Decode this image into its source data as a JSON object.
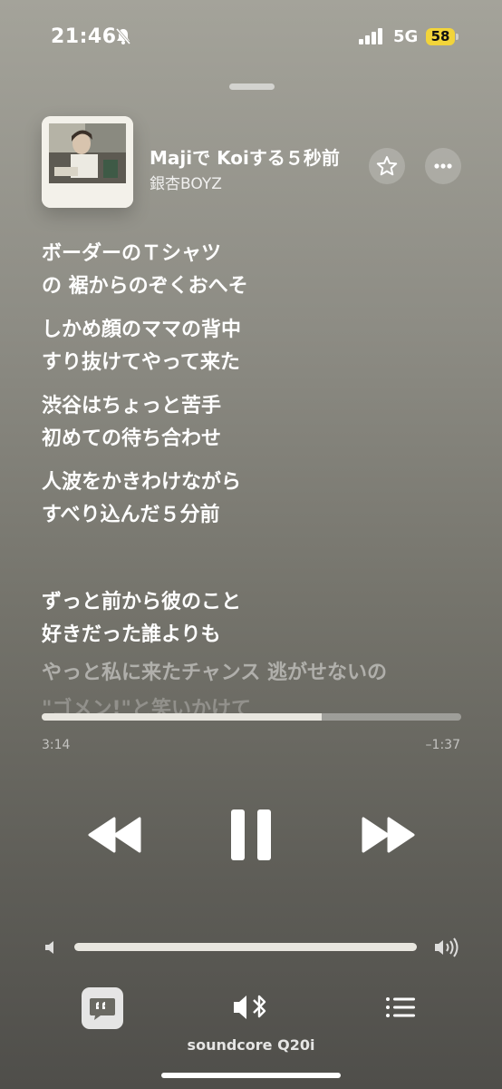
{
  "status_bar": {
    "time": "21:46",
    "network": "5G",
    "battery": "58"
  },
  "now_playing": {
    "title": "Majiで Koiする５秒前",
    "artist": "銀杏BOYZ",
    "artwork_icon": "album-artwork"
  },
  "lyrics": {
    "groups": [
      [
        "ボーダーのＴシャツ",
        "の 裾からのぞくおへそ"
      ],
      [
        "しかめ顔のママの背中",
        "すり抜けてやって来た"
      ],
      [
        "渋谷はちょっと苦手",
        "初めての待ち合わせ"
      ],
      [
        "人波をかきわけながら",
        "すべり込んだ５分前"
      ]
    ],
    "group2": [
      "ずっと前から彼のこと",
      "好きだった誰よりも"
    ],
    "upcoming": [
      "やっと私に来たチャンス 逃がせないの",
      "\"ゴメン!\"と笑いかけて"
    ]
  },
  "progress": {
    "elapsed": "3:14",
    "remaining": "–1:37",
    "fraction": 0.667
  },
  "volume": {
    "fraction": 1.0
  },
  "output_device": "soundcore Q20i",
  "colors": {
    "accent_bar": "#e8e6df",
    "battery": "#f2d43a"
  }
}
